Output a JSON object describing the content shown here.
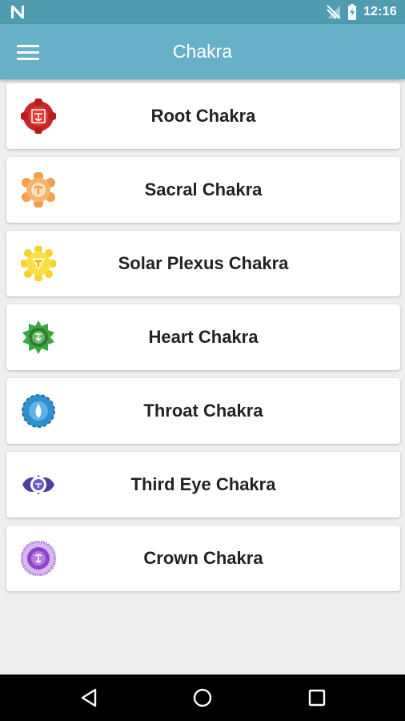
{
  "status_bar": {
    "time": "12:16",
    "icons": [
      "notification-n-icon",
      "no-signal-icon",
      "battery-charging-icon"
    ]
  },
  "app_bar": {
    "title": "Chakra",
    "menu_icon": "hamburger-menu-icon",
    "color": "#66b1c7"
  },
  "chakras": [
    {
      "label": "Root Chakra",
      "icon": "root-chakra-icon",
      "color": "#c62828"
    },
    {
      "label": "Sacral Chakra",
      "icon": "sacral-chakra-icon",
      "color": "#f0a050"
    },
    {
      "label": "Solar Plexus Chakra",
      "icon": "solar-plexus-chakra-icon",
      "color": "#f6d42b"
    },
    {
      "label": "Heart Chakra",
      "icon": "heart-chakra-icon",
      "color": "#3aa83f"
    },
    {
      "label": "Throat Chakra",
      "icon": "throat-chakra-icon",
      "color": "#2f8fcf"
    },
    {
      "label": "Third Eye Chakra",
      "icon": "third-eye-chakra-icon",
      "color": "#4b3fa0"
    },
    {
      "label": "Crown Chakra",
      "icon": "crown-chakra-icon",
      "color": "#8e44c8"
    }
  ],
  "nav_bar": {
    "buttons": [
      "back-icon",
      "home-icon",
      "recents-icon"
    ]
  }
}
